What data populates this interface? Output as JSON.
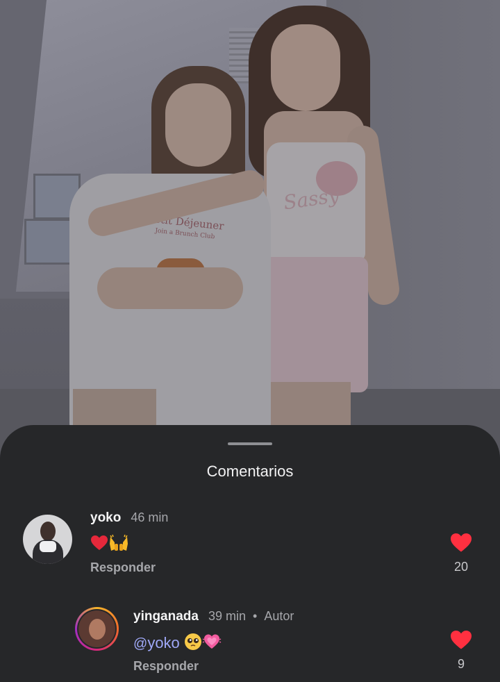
{
  "sheet": {
    "title": "Comentarios"
  },
  "comments": [
    {
      "user": "yoko",
      "time": "46 min",
      "body_emojis": [
        "red-heart",
        "raising-hands"
      ],
      "reply_label": "Responder",
      "likes": "20"
    },
    {
      "user": "yinganada",
      "time": "39 min",
      "separator": "•",
      "role": "Autor",
      "mention": "yoko",
      "body_emojis": [
        "pleading-face",
        "growing-heart"
      ],
      "reply_label": "Responder",
      "likes": "9",
      "avatar_ring": "story-gradient"
    }
  ],
  "photo": {
    "shirt_text_line1": "Petit Déjeuner",
    "shirt_text_line2": "Join a Brunch Club",
    "top_text": "Sassy"
  },
  "colors": {
    "sheet_bg": "#262729",
    "like_red": "#ff3040",
    "mention_blue": "#9fa8f7",
    "muted_text": "#a6a7ab"
  }
}
